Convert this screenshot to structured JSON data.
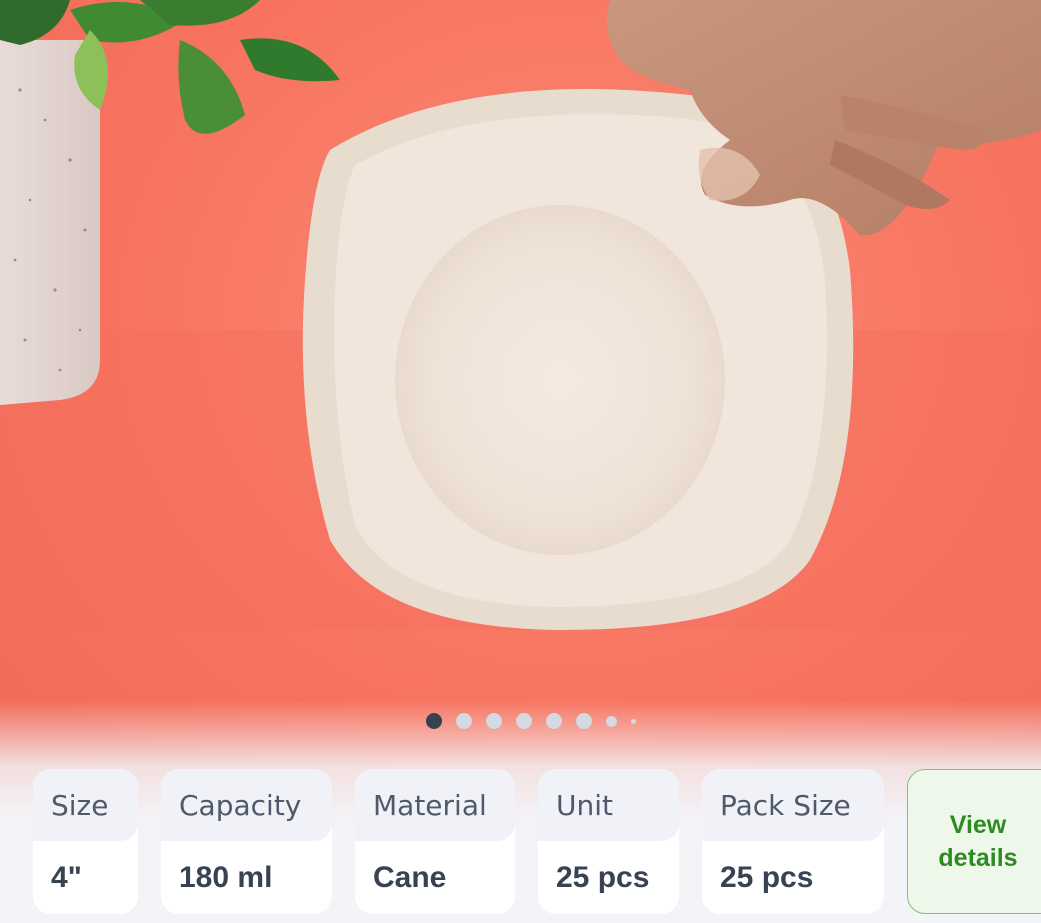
{
  "carousel": {
    "image_alt": "Cane bowl held by a hand in front of a potted plant",
    "total_slides": 8,
    "active_index": 0
  },
  "specs": [
    {
      "label": "Size",
      "value": "4\""
    },
    {
      "label": "Capacity",
      "value": "180 ml"
    },
    {
      "label": "Material",
      "value": "Cane"
    },
    {
      "label": "Unit",
      "value": "25 pcs"
    },
    {
      "label": "Pack Size",
      "value": "25 pcs"
    }
  ],
  "view_details": {
    "line1": "View",
    "line2": "details"
  },
  "colors": {
    "background": "#f7735f",
    "accent_green": "#2e8b22",
    "dot_active": "#394150",
    "dot_inactive": "#d6d9e2"
  }
}
